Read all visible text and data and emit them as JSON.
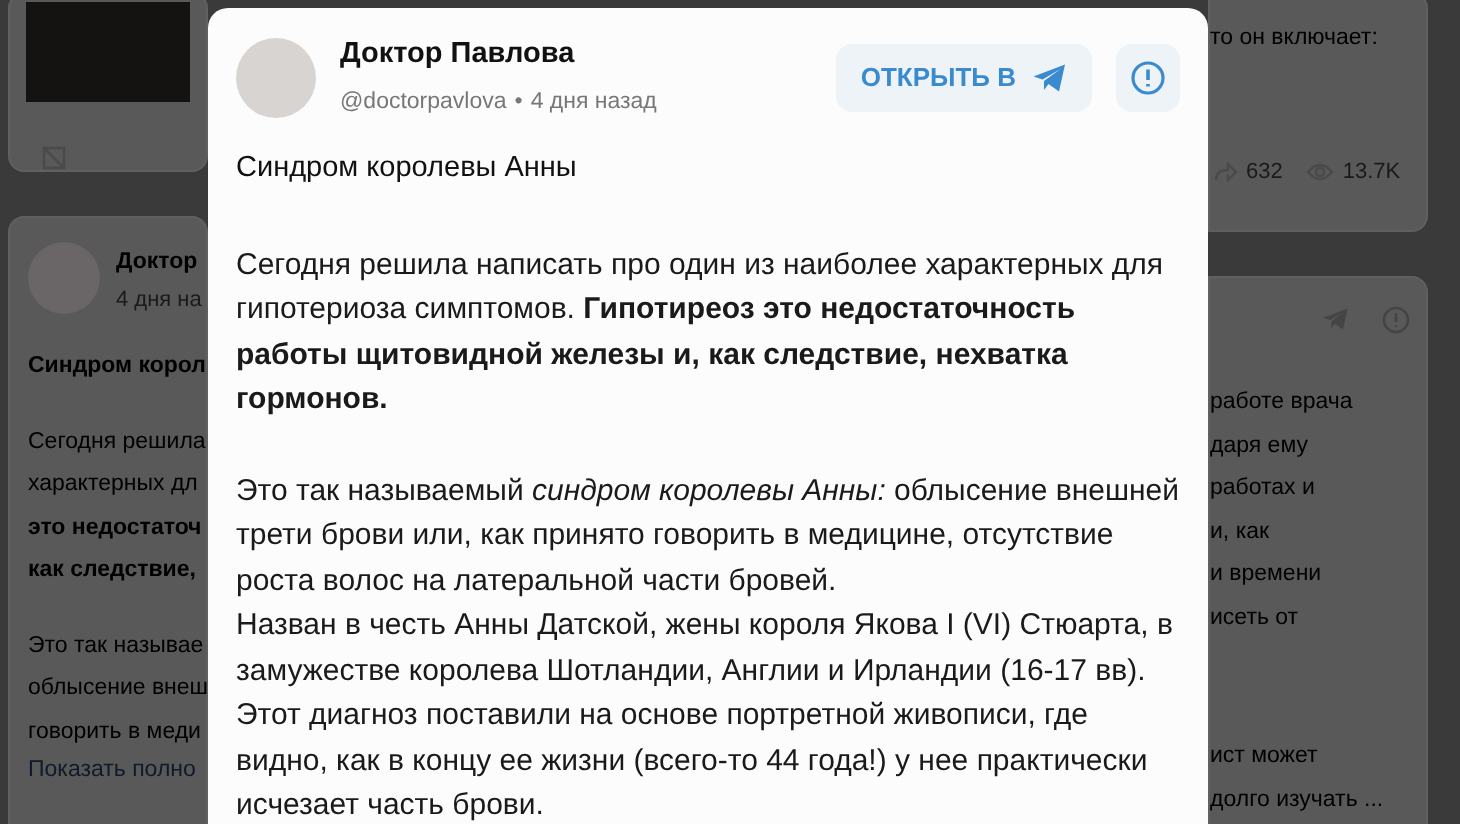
{
  "feed_left": {
    "author": "Доктор",
    "time": "4 дня на",
    "title": "Синдром корол",
    "paragraphs": [
      [
        {
          "text": "Сегодня решила",
          "bold": false
        },
        {
          "text": "характерных дл",
          "bold": false
        },
        {
          "text": "это недостаточ",
          "bold": true
        },
        {
          "text": "как следствие,",
          "bold": true
        }
      ],
      [
        {
          "text": "Это так называе",
          "bold": false
        },
        {
          "text": "облысение внеш",
          "bold": false
        },
        {
          "text": "говорить в меди",
          "bold": false
        }
      ]
    ],
    "show_more": "Показать полно"
  },
  "feed_right": {
    "top_line": "то он включает:",
    "shares": "632",
    "views": "13.7K",
    "paragraphs": [
      [
        "работе врача",
        "даря ему",
        "работах и",
        "и, как",
        "и времени",
        "исеть от"
      ],
      [
        "ист может",
        "долго изучать ..."
      ]
    ]
  },
  "modal": {
    "author": "Доктор Павлова",
    "handle": "@doctorpavlova",
    "separator": "•",
    "time": "4 дня назад",
    "open_button": "ОТКРЫТЬ В",
    "title": "Синдром королевы Анны",
    "paragraphs": [
      [
        "Сегодня решила написать про один из наиболее характерных для гипотериоза симптомов. **Гипотиреоз это недостаточность работы щитовидной железы и, как следствие, нехватка гормонов.**"
      ],
      [
        "Это так называемый *синдром королевы Анны:* облысение внешней трети брови или, как принято говорить в медицине, отсутствие роста волос на латеральной части бровей.",
        "Назван в честь Анны Датской, жены короля Якова I (VI) Стюарта, в замужестве королева Шотландии, Англии и Ирландии (16-17 вв).",
        "Этот диагноз поставили на основе портретной живописи, где видно, как в концу ее жизни (всего-то 44 года!) у нее практически исчезает часть брови."
      ]
    ]
  }
}
